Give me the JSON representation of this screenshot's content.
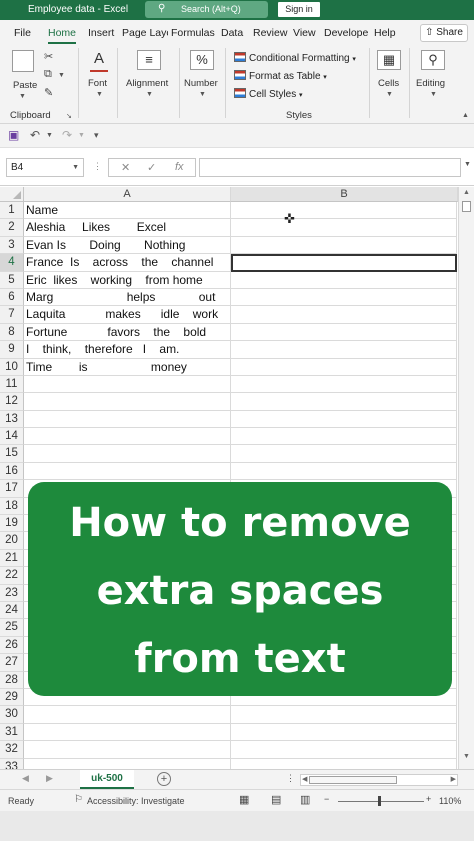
{
  "window": {
    "title": "Employee data - Excel",
    "search_label": "Search (Alt+Q)",
    "sign_in": "Sign in"
  },
  "ribbon_tabs": [
    "File",
    "Home",
    "Insert",
    "Page Layo",
    "Formulas",
    "Data",
    "Review",
    "View",
    "Develope",
    "Help"
  ],
  "share_label": "Share",
  "ribbon": {
    "paste": "Paste",
    "clipboard": "Clipboard",
    "font": "Font",
    "alignment": "Alignment",
    "number": "Number",
    "conditional_formatting": "Conditional Formatting",
    "format_as_table": "Format as Table",
    "cell_styles": "Cell Styles",
    "styles": "Styles",
    "cells": "Cells",
    "editing": "Editing"
  },
  "formula_bar": {
    "name_box": "B4",
    "formula": ""
  },
  "columns": [
    "A",
    "B"
  ],
  "active_row": 4,
  "rows": [
    {
      "n": "1",
      "a": "Name"
    },
    {
      "n": "2",
      "a": "Aleshia     Likes        Excel"
    },
    {
      "n": "3",
      "a": "Evan Is       Doing       Nothing"
    },
    {
      "n": "4",
      "a": "France  Is    across    the    channel"
    },
    {
      "n": "5",
      "a": "Eric  likes    working    from home"
    },
    {
      "n": "6",
      "a": "Marg                      helps             out"
    },
    {
      "n": "7",
      "a": "Laquita            makes      idle    work"
    },
    {
      "n": "8",
      "a": "Fortune            favors    the    bold"
    },
    {
      "n": "9",
      "a": "I    think,    therefore   I    am."
    },
    {
      "n": "10",
      "a": "Time        is                   money"
    },
    {
      "n": "11",
      "a": ""
    },
    {
      "n": "12",
      "a": ""
    },
    {
      "n": "13",
      "a": ""
    },
    {
      "n": "14",
      "a": ""
    },
    {
      "n": "15",
      "a": ""
    },
    {
      "n": "16",
      "a": ""
    },
    {
      "n": "17",
      "a": ""
    },
    {
      "n": "18",
      "a": ""
    },
    {
      "n": "19",
      "a": ""
    },
    {
      "n": "20",
      "a": ""
    },
    {
      "n": "21",
      "a": ""
    },
    {
      "n": "22",
      "a": ""
    },
    {
      "n": "23",
      "a": ""
    },
    {
      "n": "24",
      "a": ""
    },
    {
      "n": "25",
      "a": ""
    },
    {
      "n": "26",
      "a": ""
    },
    {
      "n": "27",
      "a": ""
    },
    {
      "n": "28",
      "a": ""
    },
    {
      "n": "29",
      "a": ""
    },
    {
      "n": "30",
      "a": ""
    },
    {
      "n": "31",
      "a": ""
    },
    {
      "n": "32",
      "a": ""
    },
    {
      "n": "33",
      "a": ""
    }
  ],
  "banner": {
    "line1": "How to remove",
    "line2": "extra spaces",
    "line3": "from text",
    "color": "#1e8a3c"
  },
  "sheet_tab": "uk-500",
  "status": {
    "ready": "Ready",
    "accessibility": "Accessibility: Investigate",
    "zoom": "110%"
  },
  "colors": {
    "brand": "#1e7145"
  }
}
